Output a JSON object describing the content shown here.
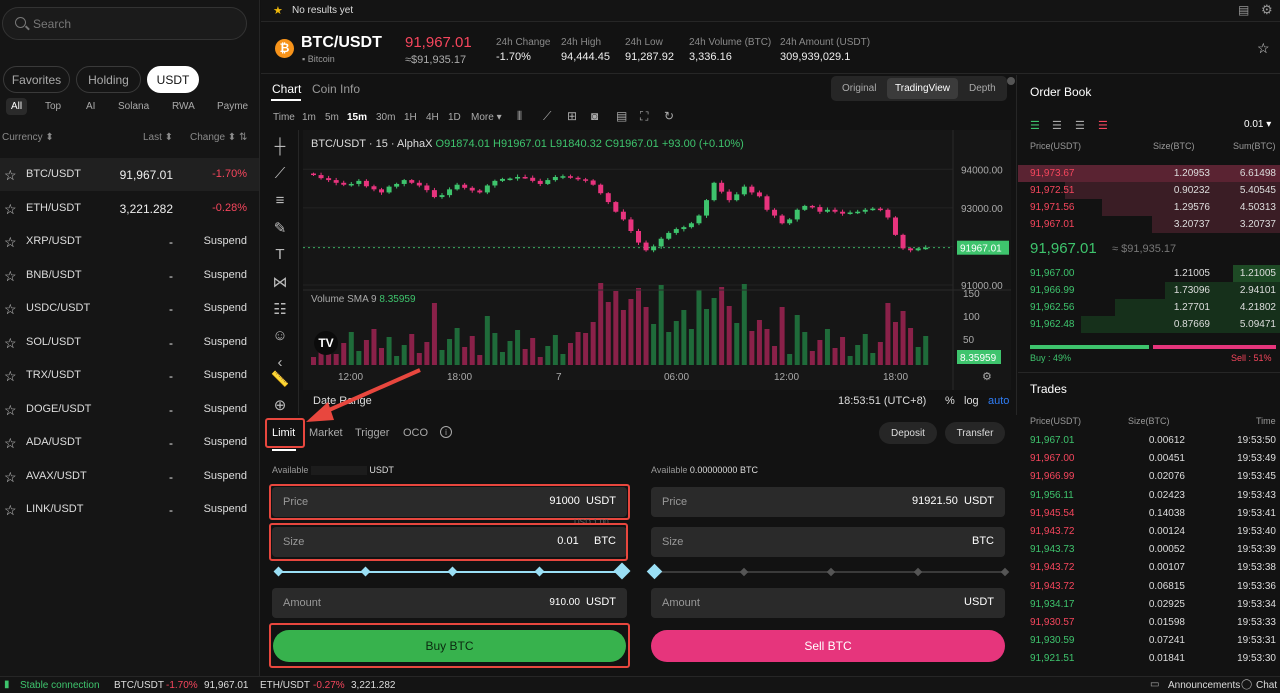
{
  "search": {
    "placeholder": "Search"
  },
  "market_tabs": [
    "Favorites",
    "Holding",
    "USDT"
  ],
  "categories": [
    "All",
    "Top",
    "AI",
    "Solana",
    "RWA",
    "Payme"
  ],
  "market_cols": {
    "currency": "Currency",
    "last": "Last",
    "change": "Change"
  },
  "markets": [
    {
      "sym": "BTC/USDT",
      "price": "91,967.01",
      "chg": "-1.70%"
    },
    {
      "sym": "ETH/USDT",
      "price": "3,221.282",
      "chg": "-0.28%"
    },
    {
      "sym": "XRP/USDT",
      "price": "-",
      "chg": "Suspend"
    },
    {
      "sym": "BNB/USDT",
      "price": "-",
      "chg": "Suspend"
    },
    {
      "sym": "USDC/USDT",
      "price": "-",
      "chg": "Suspend"
    },
    {
      "sym": "SOL/USDT",
      "price": "-",
      "chg": "Suspend"
    },
    {
      "sym": "TRX/USDT",
      "price": "-",
      "chg": "Suspend"
    },
    {
      "sym": "DOGE/USDT",
      "price": "-",
      "chg": "Suspend"
    },
    {
      "sym": "ADA/USDT",
      "price": "-",
      "chg": "Suspend"
    },
    {
      "sym": "AVAX/USDT",
      "price": "-",
      "chg": "Suspend"
    },
    {
      "sym": "LINK/USDT",
      "price": "-",
      "chg": "Suspend"
    }
  ],
  "topbar": {
    "favorites_msg": "No results yet"
  },
  "header": {
    "pair": "BTC/USDT",
    "coin_name": "Bitcoin",
    "coin_symbol": "₿",
    "price": "91,967.01",
    "price_fiat": "≈$91,935.17",
    "stats": [
      {
        "label": "24h Change",
        "value": "-1.70%"
      },
      {
        "label": "24h High",
        "value": "94,444.45"
      },
      {
        "label": "24h Low",
        "value": "91,287.92"
      },
      {
        "label": "24h Volume (BTC)",
        "value": "3,336.16"
      },
      {
        "label": "24h Amount (USDT)",
        "value": "309,939,029.1"
      }
    ]
  },
  "chart_tabs": {
    "chart": "Chart",
    "coin_info": "Coin Info"
  },
  "view_modes": [
    "Original",
    "TradingView",
    "Depth"
  ],
  "timeframes": [
    "Time",
    "1m",
    "5m",
    "15m",
    "30m",
    "1H",
    "4H",
    "1D",
    "More"
  ],
  "chart_legend": {
    "title": "BTC/USDT · 15 · AlphaX",
    "o": "O91874.01",
    "h": "H91967.01",
    "l": "L91840.32",
    "c": "C91967.01",
    "chg": "+93.00 (+0.10%)"
  },
  "volume_legend": {
    "label": "Volume SMA 9",
    "value": "8.35959"
  },
  "footer_chart": {
    "date_range": "Date Range",
    "clock": "18:53:51 (UTC+8)",
    "pct": "%",
    "log": "log",
    "auto": "auto"
  },
  "chart_data": {
    "type": "candlestick",
    "price_axis": [
      "94000.00",
      "93000.00",
      "92000.00",
      "91000.00"
    ],
    "ylim": [
      91000,
      94500
    ],
    "last_price": 91967.01,
    "last_price_label": "91967.01",
    "volume_axis": [
      "150",
      "100",
      "50"
    ],
    "volume_last_label": "8.35959",
    "time_axis": [
      "12:00",
      "18:00",
      "7",
      "06:00",
      "12:00",
      "18:00"
    ],
    "closes": [
      93850,
      93770,
      93720,
      93650,
      93600,
      93620,
      93700,
      93560,
      93480,
      93400,
      93550,
      93620,
      93720,
      93650,
      93580,
      93460,
      93280,
      93330,
      93480,
      93600,
      93520,
      93450,
      93400,
      93580,
      93700,
      93750,
      93760,
      93800,
      93780,
      93700,
      93620,
      93720,
      93800,
      93820,
      93780,
      93740,
      93710,
      93600,
      93380,
      93150,
      92900,
      92700,
      92400,
      92100,
      91900,
      92000,
      92200,
      92350,
      92450,
      92500,
      92600,
      92800,
      93200,
      93650,
      93420,
      93200,
      93350,
      93550,
      93400,
      93300,
      92950,
      92800,
      92600,
      92700,
      92950,
      93050,
      93020,
      92900,
      92950,
      92900,
      92850,
      92880,
      92900,
      92950,
      92980,
      92950,
      92750,
      92300,
      91950,
      91900,
      91950,
      91967
    ]
  },
  "form_tabs": [
    "Limit",
    "Market",
    "Trigger",
    "OCO"
  ],
  "form_buttons": {
    "deposit": "Deposit",
    "transfer": "Transfer"
  },
  "buy": {
    "available_label": "Available",
    "available_unit": "USDT",
    "price_label": "Price",
    "price_value": "91000",
    "price_unit": "USDT",
    "size_label": "Size",
    "size_value": "0.01",
    "size_unit": "BTC",
    "size_hint": "USD 1.00",
    "amount_label": "Amount",
    "amount_value": "910.00",
    "amount_unit": "USDT",
    "button": "Buy BTC"
  },
  "sell": {
    "available_label": "Available",
    "available_value": "0.00000000 BTC",
    "price_label": "Price",
    "price_value": "91921.50",
    "price_unit": "USDT",
    "size_label": "Size",
    "size_unit": "BTC",
    "amount_label": "Amount",
    "amount_unit": "USDT",
    "button": "Sell BTC"
  },
  "orderbook": {
    "title": "Order Book",
    "precision": "0.01",
    "cols": {
      "price": "Price(USDT)",
      "size": "Size(BTC)",
      "sum": "Sum(BTC)"
    },
    "asks": [
      {
        "p": "91,973.67",
        "s": "1.20953",
        "t": "6.61498",
        "depth": 1.0
      },
      {
        "p": "91,972.51",
        "s": "0.90232",
        "t": "5.40545",
        "depth": 0.82
      },
      {
        "p": "91,971.56",
        "s": "1.29576",
        "t": "4.50313",
        "depth": 0.68
      },
      {
        "p": "91,967.01",
        "s": "3.20737",
        "t": "3.20737",
        "depth": 0.49
      }
    ],
    "mid_price": "91,967.01",
    "mid_fiat": "≈ $91,935.17",
    "bids": [
      {
        "p": "91,967.00",
        "s": "1.21005",
        "t": "1.21005",
        "depth": 0.18
      },
      {
        "p": "91,966.99",
        "s": "1.73096",
        "t": "2.94101",
        "depth": 0.44
      },
      {
        "p": "91,962.56",
        "s": "1.27701",
        "t": "4.21802",
        "depth": 0.63
      },
      {
        "p": "91,962.48",
        "s": "0.87669",
        "t": "5.09471",
        "depth": 0.76
      }
    ],
    "buy_ratio": "Buy : 49%",
    "sell_ratio": "Sell : 51%",
    "buy_pct": 49
  },
  "trades": {
    "title": "Trades",
    "cols": {
      "price": "Price(USDT)",
      "size": "Size(BTC)",
      "time": "Time"
    },
    "rows": [
      {
        "p": "91,967.01",
        "s": "0.00612",
        "t": "19:53:50",
        "side": "buy"
      },
      {
        "p": "91,967.00",
        "s": "0.00451",
        "t": "19:53:49",
        "side": "sell"
      },
      {
        "p": "91,966.99",
        "s": "0.02076",
        "t": "19:53:45",
        "side": "sell"
      },
      {
        "p": "91,956.11",
        "s": "0.02423",
        "t": "19:53:43",
        "side": "buy"
      },
      {
        "p": "91,945.54",
        "s": "0.14038",
        "t": "19:53:41",
        "side": "sell"
      },
      {
        "p": "91,943.72",
        "s": "0.00124",
        "t": "19:53:40",
        "side": "sell"
      },
      {
        "p": "91,943.73",
        "s": "0.00052",
        "t": "19:53:39",
        "side": "buy"
      },
      {
        "p": "91,943.72",
        "s": "0.00107",
        "t": "19:53:38",
        "side": "sell"
      },
      {
        "p": "91,943.72",
        "s": "0.06815",
        "t": "19:53:36",
        "side": "sell"
      },
      {
        "p": "91,934.17",
        "s": "0.02925",
        "t": "19:53:34",
        "side": "buy"
      },
      {
        "p": "91,930.57",
        "s": "0.01598",
        "t": "19:53:33",
        "side": "sell"
      },
      {
        "p": "91,930.59",
        "s": "0.07241",
        "t": "19:53:31",
        "side": "buy"
      },
      {
        "p": "91,921.51",
        "s": "0.01841",
        "t": "19:53:30",
        "side": "buy"
      }
    ]
  },
  "status": {
    "connection": "Stable connection",
    "t1_sym": "BTC/USDT",
    "t1_chg": "-1.70%",
    "t1_price": "91,967.01",
    "t2_sym": "ETH/USDT",
    "t2_chg": "-0.27%",
    "t2_price": "3,221.282",
    "announcements": "Announcements",
    "chat": "Chat"
  },
  "colors": {
    "up": "#3ec46d",
    "down": "#f6465d",
    "buy_button": "#37b24d",
    "sell_button": "#e6357c",
    "highlight": "#e8473e"
  }
}
